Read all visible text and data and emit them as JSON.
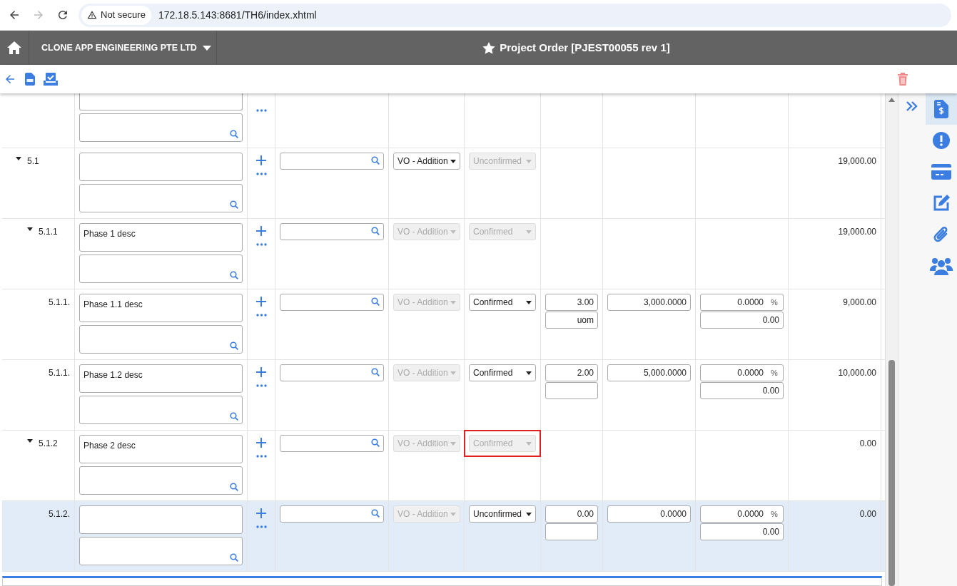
{
  "browser": {
    "insecure_label": "Not secure",
    "url": "172.18.5.143:8681/TH6/index.xhtml",
    "forward_disabled": true
  },
  "header": {
    "company": "CLONE APP ENGINEERING PTE LTD",
    "title": "Project Order [PJEST00055 rev 1]"
  },
  "rows": [
    {
      "kind": "partial",
      "selected": false
    },
    {
      "kind": "item",
      "number": "5.1",
      "expanded": true,
      "selected": false,
      "type": {
        "value": "VO - Addition",
        "disabled": false
      },
      "status": {
        "value": "Unconfirmed",
        "disabled": true,
        "highlighted": false
      },
      "total": "19,000.00",
      "children": [
        {
          "kind": "item",
          "number": "5.1.1",
          "expanded": true,
          "selected": false,
          "description": "Phase 1 desc",
          "type": {
            "value": "VO - Addition",
            "disabled": true
          },
          "status": {
            "value": "Confirmed",
            "disabled": true,
            "highlighted": false
          },
          "total": "19,000.00",
          "children": [
            {
              "kind": "item",
              "number": "5.1.1.",
              "selected": false,
              "description": "Phase 1.1 desc",
              "type": {
                "value": "VO - Addition",
                "disabled": true
              },
              "status": {
                "value": "Confirmed",
                "disabled": false,
                "highlighted": false
              },
              "qty": "3.00",
              "uom": "uom",
              "price": "3,000.0000",
              "discount": "0.0000",
              "discount_unit": "%",
              "discount_amount": "0.00",
              "total": "9,000.00"
            },
            {
              "kind": "item",
              "number": "5.1.1.",
              "selected": false,
              "description": "Phase 1.2 desc",
              "type": {
                "value": "VO - Addition",
                "disabled": true
              },
              "status": {
                "value": "Confirmed",
                "disabled": false,
                "highlighted": false
              },
              "qty": "2.00",
              "price": "5,000.0000",
              "discount": "0.0000",
              "discount_unit": "%",
              "discount_amount": "0.00",
              "total": "10,000.00"
            }
          ]
        },
        {
          "kind": "item",
          "number": "5.1.2",
          "expanded": true,
          "selected": false,
          "description": "Phase 2 desc",
          "type": {
            "value": "VO - Addition",
            "disabled": true
          },
          "status": {
            "value": "Confirmed",
            "disabled": true,
            "highlighted": true
          },
          "total": "0.00",
          "children": [
            {
              "kind": "item",
              "number": "5.1.2.",
              "selected": true,
              "type": {
                "value": "VO - Addition",
                "disabled": true
              },
              "status": {
                "value": "Unconfirmed",
                "disabled": false,
                "highlighted": false
              },
              "qty": "0.00",
              "price": "0.0000",
              "discount": "0.0000",
              "discount_unit": "%",
              "discount_amount": "0.00",
              "total": "0.00"
            }
          ]
        }
      ]
    }
  ],
  "sidebar": {
    "items": [
      {
        "selected": true
      },
      {
        "selected": false
      },
      {
        "selected": false
      },
      {
        "selected": false
      },
      {
        "selected": false
      },
      {
        "selected": false
      }
    ]
  }
}
